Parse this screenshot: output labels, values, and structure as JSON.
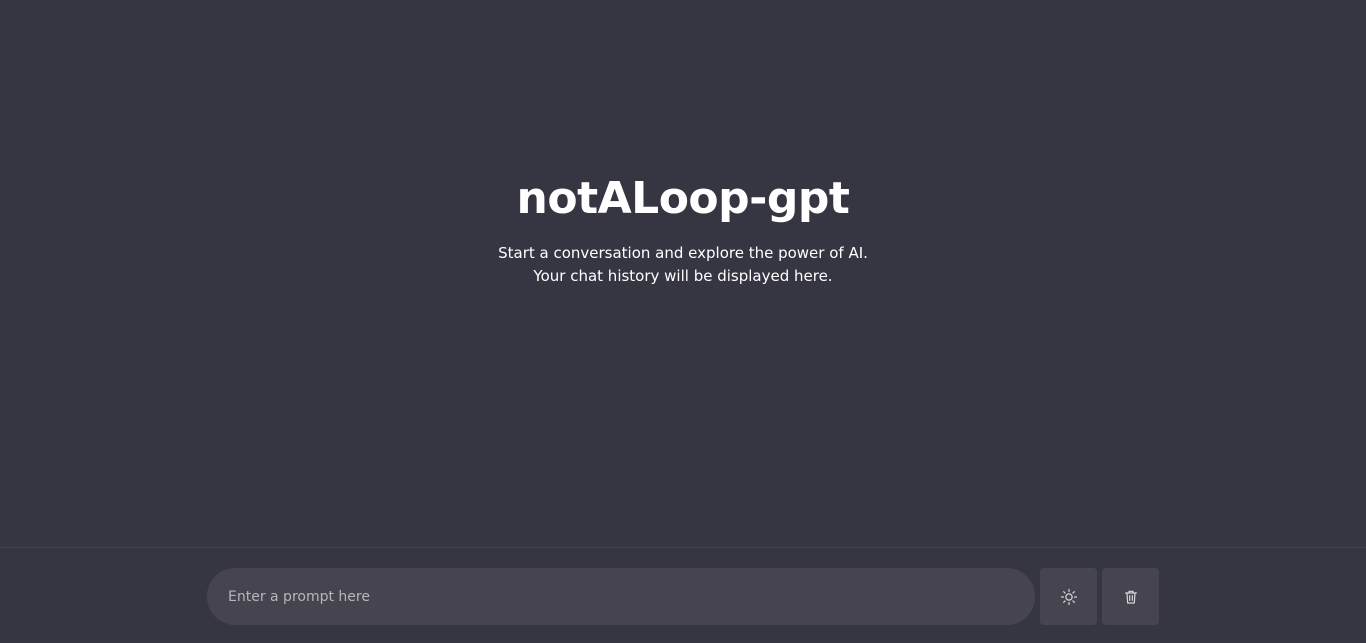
{
  "hero": {
    "title": "notALoop-gpt",
    "subtitle_line1": "Start a conversation and explore the power of AI.",
    "subtitle_line2": "Your chat history will be displayed here."
  },
  "prompt": {
    "placeholder": "Enter a prompt here",
    "value": ""
  },
  "buttons": {
    "theme_icon": "sun-icon",
    "delete_icon": "trash-icon"
  },
  "colors": {
    "background": "#363542",
    "input_background": "#46454f",
    "text": "#ffffff",
    "placeholder": "#b6b5bd"
  }
}
